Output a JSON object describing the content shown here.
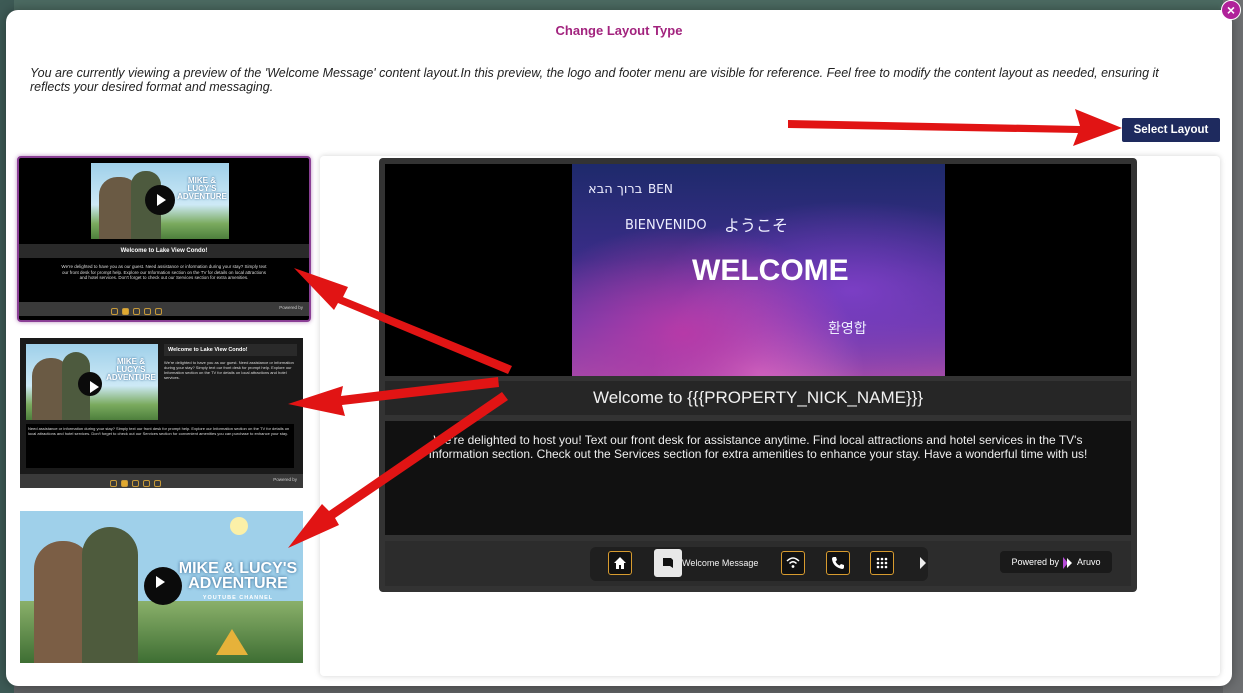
{
  "modal": {
    "title": "Change Layout Type",
    "description": "You are currently viewing a preview of the 'Welcome Message' content layout.In this preview, the logo and footer menu are visible for reference. Feel free to modify the content layout as needed, ensuring it reflects your desired format and messaging.",
    "select_button": "Select Layout",
    "close_icon": "×"
  },
  "thumbnails": [
    {
      "name": "layout-option-1",
      "selected": true,
      "title": "Welcome to Lake View Condo!",
      "video_title": "MIKE & LUCY'S ADVENTURE"
    },
    {
      "name": "layout-option-2",
      "selected": false,
      "title": "Welcome to Lake View Condo!",
      "video_title": "MIKE & LUCY'S ADVENTURE"
    },
    {
      "name": "layout-option-3",
      "selected": false,
      "video_title": "MIKE & LUCY'S ADVENTURE",
      "video_subtitle": "YOUTUBE CHANNEL"
    }
  ],
  "thumb_text": {
    "t1_body": "We're delighted to have you as our guest. Need assistance or information during your stay? Simply text our front desk for prompt help. Explore our Information section on the TV for details on local attractions and hotel services. Don't forget to check out our Services section for extra amenities.",
    "t2_body_short": "We're delighted to have you as our guest. Need assistance or information during your stay? Simply text our front desk for prompt help. Explore our Information section on the TV for details on local attractions and hotel services.",
    "t2_body_long": "Need assistance or information during your stay? Simply text our front desk for prompt help. Explore our Information section on the TV for details on local attractions and hotel services. Don't forget to check out our Services section for convenient amenities you can purchase to enhance your stay.",
    "powered_small": "Powered by"
  },
  "preview": {
    "hero_words": {
      "hebrew": "ברוך הבא",
      "ben": "BEN",
      "bienvenido": "BIENVENIDO",
      "japanese": "ようこそ",
      "welcome": "WELCOME",
      "korean": "환영합"
    },
    "title": "Welcome to {{{PROPERTY_NICK_NAME}}}",
    "body": "We're delighted to host you! Text our front desk for assistance anytime. Find local attractions and hotel services in the TV's Information section. Check out the Services section for extra amenities to enhance your stay. Have a wonderful time with us!",
    "footer": {
      "nav_items": [
        "home-icon",
        "message-icon",
        "wifi-icon",
        "phone-icon",
        "apps-icon"
      ],
      "active_label": "Welcome Message",
      "powered_by": "Powered by",
      "brand": "Aruvo"
    }
  },
  "colors": {
    "accent": "#a2237e",
    "button": "#1e2a5e",
    "arrow": "#e11414",
    "nav_border": "#d79b2f"
  }
}
